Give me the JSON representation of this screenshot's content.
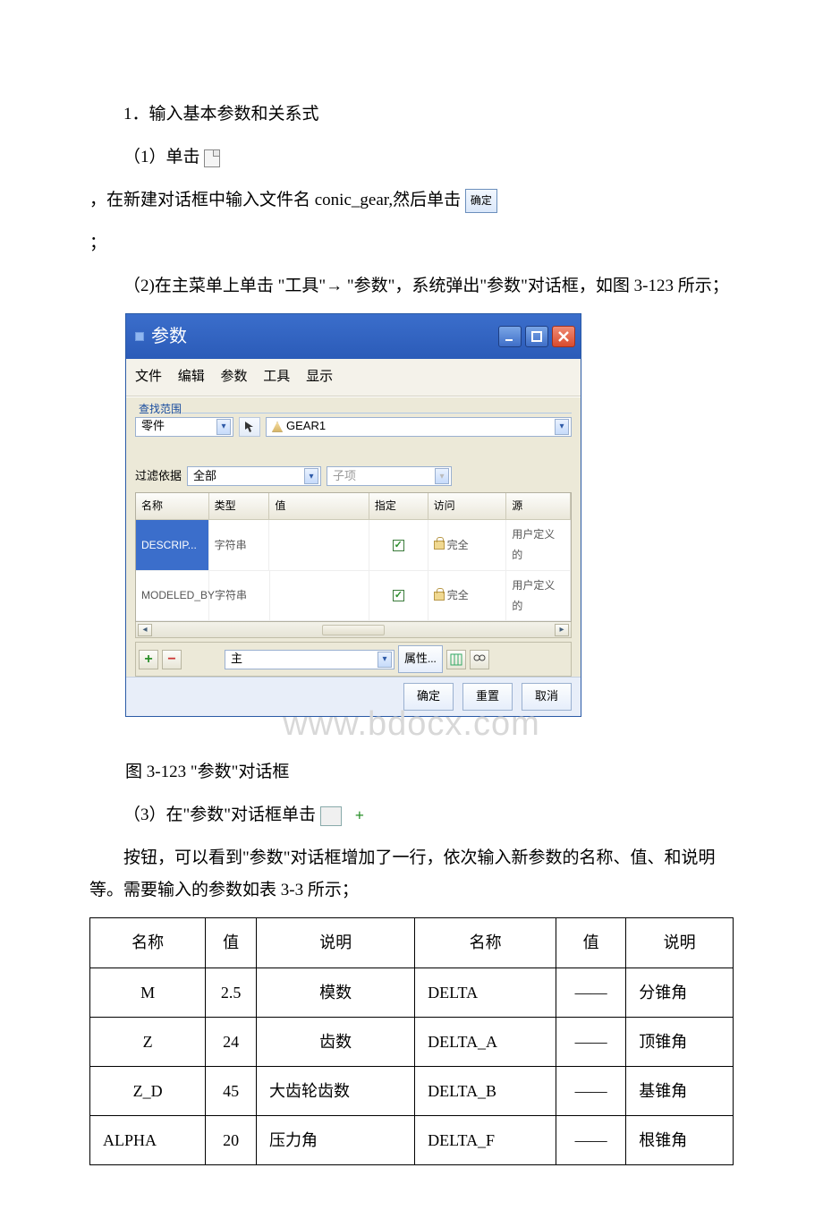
{
  "text": {
    "step1": "1．输入基本参数和关系式",
    "bullet1a": "（1）单击",
    "bullet1b": "，在新建对话框中输入文件名 conic_gear,然后单击",
    "semicolon": "；",
    "step2": "（2)在主菜单上单击 \"工具\"→ \"参数\"，系统弹出\"参数\"对话框，如图 3-123 所示；",
    "caption_dialog": "图 3-123 \"参数\"对话框",
    "bullet3": "（3）在\"参数\"对话框单击",
    "after3": "按钮，可以看到\"参数\"对话框增加了一行，依次输入新参数的名称、值、和说明等。需要输入的参数如表 3-3 所示；"
  },
  "inline_buttons": {
    "ok_label": "确定"
  },
  "dialog": {
    "title": "参数",
    "menu": [
      "文件",
      "编辑",
      "参数",
      "工具",
      "显示"
    ],
    "scope_label": "查找范围",
    "scope_value": "零件",
    "scope_file": "GEAR1",
    "filter_label": "过滤依据",
    "filter_value": "全部",
    "filter_sub": "子项",
    "columns": [
      "名称",
      "类型",
      "值",
      "指定",
      "访问",
      "源"
    ],
    "rows": [
      {
        "name": "DESCRIP...",
        "type": "字符串",
        "value": "",
        "access": "完全",
        "source": "用户定义的"
      },
      {
        "name": "MODELED_BY",
        "type": "字符串",
        "value": "",
        "access": "完全",
        "source": "用户定义的"
      }
    ],
    "main_label": "主",
    "props_label": "属性...",
    "footer": {
      "ok": "确定",
      "reset": "重置",
      "cancel": "取消"
    }
  },
  "watermark": "www.bdocx.com",
  "table": {
    "headers": [
      "名称",
      "值",
      "说明",
      "名称",
      "值",
      "说明"
    ],
    "rows": [
      [
        "M",
        "2.5",
        "模数",
        "DELTA",
        "——",
        "分锥角"
      ],
      [
        "Z",
        "24",
        "齿数",
        "DELTA_A",
        "——",
        "顶锥角"
      ],
      [
        "Z_D",
        "45",
        "大齿轮齿数",
        "DELTA_B",
        "——",
        "基锥角"
      ],
      [
        "ALPHA",
        "20",
        "压力角",
        "DELTA_F",
        "——",
        "根锥角"
      ]
    ]
  }
}
